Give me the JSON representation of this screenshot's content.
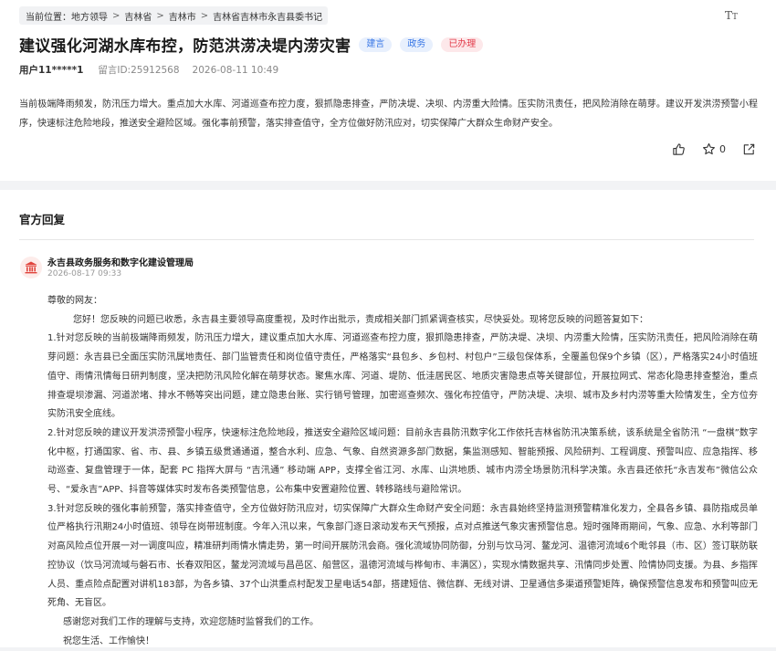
{
  "breadcrumb": {
    "prefix": "当前位置：",
    "items": [
      "地方领导",
      "吉林省",
      "吉林市",
      "吉林省吉林市永吉县委书记"
    ]
  },
  "font_toggle": {
    "large": "T",
    "small": "T"
  },
  "message": {
    "title": "建议强化河湖水库布控，防范洪涝决堤内涝灾害",
    "tags": [
      "建言",
      "政务",
      "已办理"
    ],
    "user": "用户11*****1",
    "message_id": "留言ID:25912568",
    "time": "2026-08-11 10:49",
    "content": "当前极端降雨频发，防汛压力增大。重点加大水库、河道巡查布控力度，狠抓隐患排查，严防决堤、决坝、内涝重大险情。压实防汛责任，把风险消除在萌芽。建议开发洪涝预警小程序，快速标注危险地段，推送安全避险区域。强化事前预警，落实排查值守，全方位做好防汛应对，切实保障广大群众生命财产安全。",
    "star_count": "0"
  },
  "reply": {
    "section_title": "官方回复",
    "org": "永吉县政务服务和数字化建设管理局",
    "time": "2026-08-17 09:33",
    "greeting": "尊敬的网友：",
    "intro": "您好！您反映的问题已收悉，永吉县主要领导高度重视，及时作出批示，责成相关部门抓紧调查核实，尽快妥处。现将您反映的问题答复如下：",
    "point1": "1.针对您反映的当前极端降雨频发，防汛压力增大，建议重点加大水库、河道巡查布控力度，狠抓隐患排查，严防决堤、决坝、内涝重大险情，压实防汛责任，把风险消除在萌芽问题：永吉县已全面压实防汛属地责任、部门监管责任和岗位值守责任，严格落实“县包乡、乡包村、村包户”三级包保体系，全覆盖包保9个乡镇（区），严格落实24小时值班值守、雨情汛情每日研判制度，坚决把防汛风险化解在萌芽状态。聚焦水库、河道、堤防、低洼居民区、地质灾害隐患点等关键部位，开展拉网式、常态化隐患排查整治，重点排查堤坝渗漏、河道淤堵、排水不畅等突出问题，建立隐患台账、实行销号管理，加密巡查频次、强化布控值守，严防决堤、决坝、城市及乡村内涝等重大险情发生，全方位夯实防汛安全底线。",
    "point2": "2.针对您反映的建议开发洪涝预警小程序，快速标注危险地段，推送安全避险区域问题：目前永吉县防汛数字化工作依托吉林省防汛决策系统，该系统是全省防汛 “一盘棋”数字化中枢，打通国家、省、市、县、乡镇五级贯通通道，整合水利、应急、气象、自然资源多部门数据，集监测感知、智能预报、风险研判、工程调度、预警叫应、应急指挥、移动巡查、复盘管理于一体，配套 PC 指挥大屏与 “吉汛通” 移动端 APP，支撑全省江河、水库、山洪地质、城市内涝全场景防汛科学决策。永吉县还依托“永吉发布”微信公众号、“爱永吉”APP、抖音等媒体实时发布各类预警信息，公布集中安置避险位置、转移路线与避险常识。",
    "point3": "3.针对您反映的强化事前预警，落实排查值守，全方位做好防汛应对，切实保障广大群众生命财产安全问题：永吉县始终坚持监测预警精准化发力，全县各乡镇、县防指成员单位严格执行汛期24小时值班、领导在岗带班制度。今年入汛以来，气象部门逐日滚动发布天气预报，点对点推送气象灾害预警信息。短时强降雨期间，气象、应急、水利等部门对高风险点位开展一对一调度叫应，精准研判雨情水情走势，第一时间开展防汛会商。强化流域协同防御，分别与饮马河、鳌龙河、温德河流域6个毗邻县（市、区）签订联防联控协议（饮马河流域与磐石市、长春双阳区，鳌龙河流域与昌邑区、船营区，温德河流域与桦甸市、丰满区），实现水情数据共享、汛情同步处置、险情协同支援。为县、乡指挥人员、重点险点配置对讲机183部，为各乡镇、37个山洪重点村配发卫星电话54部，搭建短信、微信群、无线对讲、卫星通信多渠道预警矩阵，确保预警信息发布和预警叫应无死角、无盲区。",
    "thanks": "感谢您对我们工作的理解与支持，欢迎您随时监督我们的工作。",
    "wish": "祝您生活、工作愉快！"
  },
  "icons": {
    "font_size": "font-size-icon",
    "like": "thumbs-up-icon",
    "star": "star-icon",
    "share": "share-icon",
    "org": "government-building-icon"
  },
  "colors": {
    "tag_blue_text": "#3a78e6",
    "tag_blue_bg": "#e8f0fd",
    "tag_red_text": "#e23b4a",
    "tag_red_bg": "#fde8ea",
    "org_icon": "#e0453e"
  }
}
